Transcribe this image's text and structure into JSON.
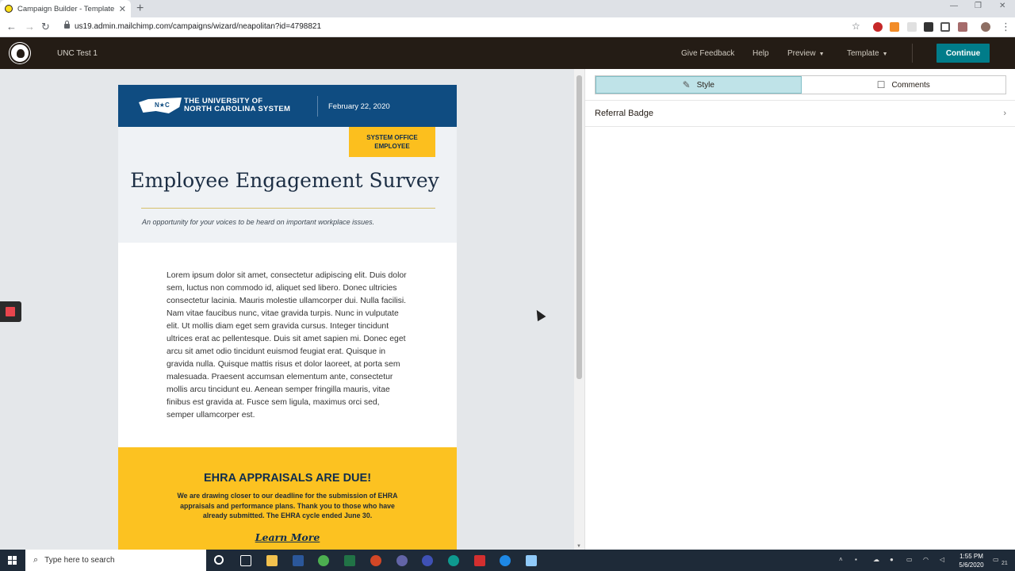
{
  "browser": {
    "tab_title": "Campaign Builder - Template De",
    "url": "us19.admin.mailchimp.com/campaigns/wizard/neapolitan?id=4798821"
  },
  "header": {
    "campaign_name": "UNC Test 1",
    "give_feedback": "Give Feedback",
    "help": "Help",
    "preview": "Preview",
    "template": "Template",
    "continue": "Continue"
  },
  "email": {
    "logo_mark": "N★C",
    "org_line1": "THE UNIVERSITY OF",
    "org_line2": "NORTH CAROLINA SYSTEM",
    "date": "February 22, 2020",
    "badge": "SYSTEM OFFICE\nEMPLOYEE",
    "title": "Employee Engagement Survey",
    "subtitle": "An opportunity for your voices to be heard on important workplace issues.",
    "body": "Lorem ipsum dolor sit amet, consectetur adipiscing elit. Duis dolor sem, luctus non commodo id, aliquet sed libero. Donec ultricies consectetur lacinia. Mauris molestie ullamcorper dui. Nulla facilisi. Nam vitae faucibus nunc, vitae gravida turpis. Nunc in vulputate elit. Ut mollis diam eget sem gravida cursus. Integer tincidunt ultrices erat ac pellentesque. Duis sit amet sapien mi. Donec eget arcu sit amet odio tincidunt euismod feugiat erat. Quisque in gravida nulla. Quisque mattis risus et dolor laoreet, at porta sem malesuada. Praesent accumsan elementum ante, consectetur mollis arcu tincidunt eu. Aenean semper fringilla mauris, vitae finibus est gravida at. Fusce sem ligula, maximus orci sed, semper ullamcorper est.",
    "banner_heading": "EHRA APPRAISALS ARE DUE!",
    "banner_text": "We are drawing closer to our deadline for the submission of EHRA appraisals and performance plans. Thank you to those who have already submitted. The EHRA cycle ended June 30.",
    "banner_link": "Learn More"
  },
  "panel": {
    "tab_style": "Style",
    "tab_comments": "Comments",
    "row_label": "Referral Badge"
  },
  "taskbar": {
    "search_placeholder": "Type here to search",
    "time": "1:55 PM",
    "date": "5/6/2020",
    "notifications": "21"
  },
  "colors": {
    "mailchimp_dark": "#241c15",
    "continue_teal": "#007c89",
    "unc_navy": "#0f4c81",
    "unc_gold": "#fcc221",
    "style_tab_active": "#bfe3e8"
  }
}
